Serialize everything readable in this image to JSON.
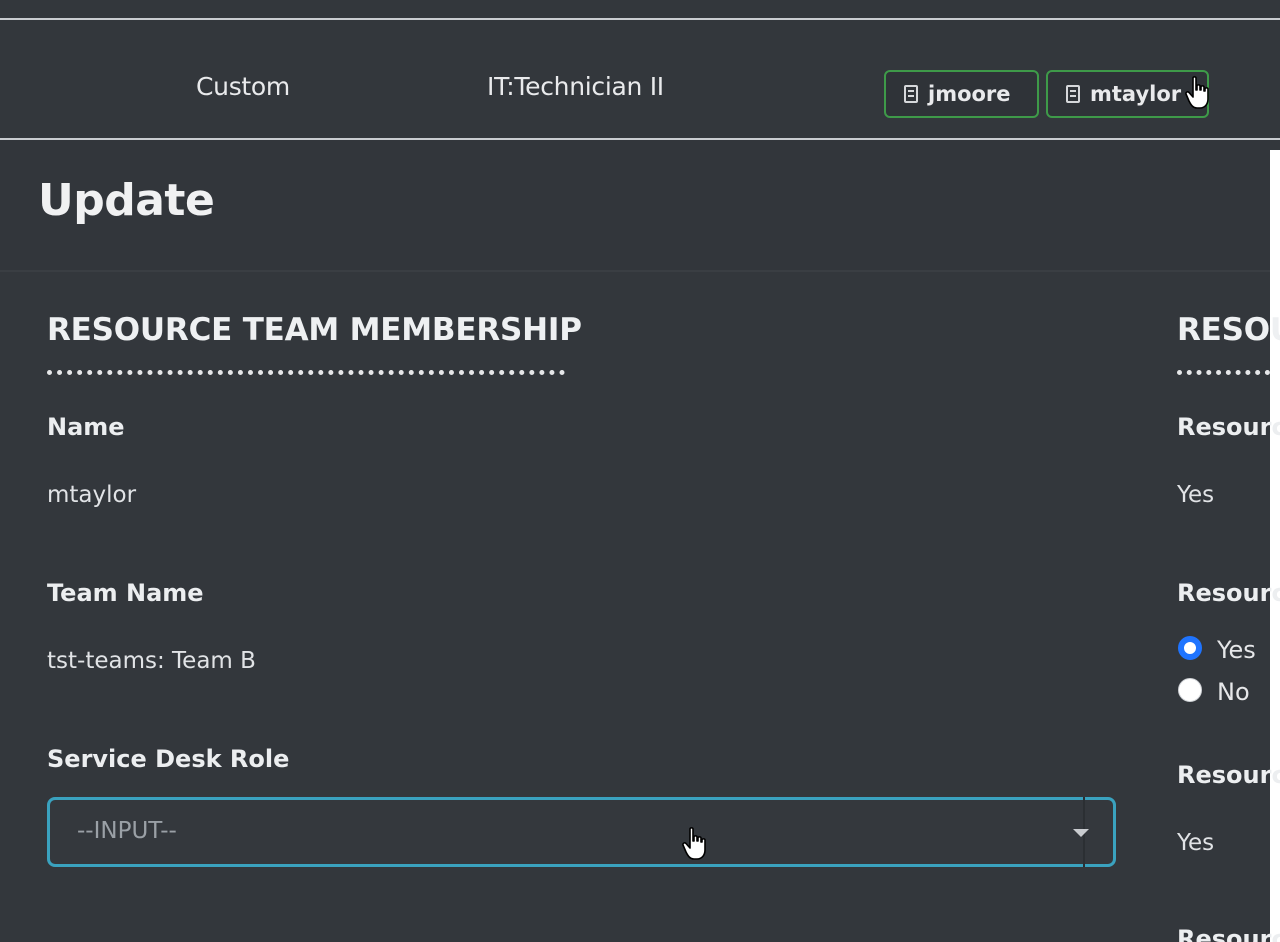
{
  "table_row": {
    "type": "Custom",
    "role": "IT:Technician II",
    "chips": [
      {
        "label": "jmoore",
        "icon": "document-icon"
      },
      {
        "label": "mtaylor",
        "icon": "document-icon"
      }
    ]
  },
  "update": {
    "title": "Update"
  },
  "left_section": {
    "title": "RESOURCE TEAM MEMBERSHIP",
    "fields": [
      {
        "label": "Name",
        "value": "mtaylor"
      },
      {
        "label": "Team Name",
        "value": "tst-teams: Team B"
      },
      {
        "label": "Service Desk Role",
        "placeholder": "--INPUT--"
      }
    ]
  },
  "right_section": {
    "title": "RESOU",
    "fields": [
      {
        "label": "Resourc",
        "value": "Yes"
      },
      {
        "label": "Resourc",
        "options": [
          "Yes",
          "No"
        ],
        "selected": "Yes"
      },
      {
        "label": "Resourc",
        "value": "Yes"
      },
      {
        "label": "Resourc"
      }
    ]
  },
  "colors": {
    "background": "#33373c",
    "chip_border": "#3e9a49",
    "select_focus": "#3aa2bf",
    "radio_selected": "#1f74ff"
  }
}
